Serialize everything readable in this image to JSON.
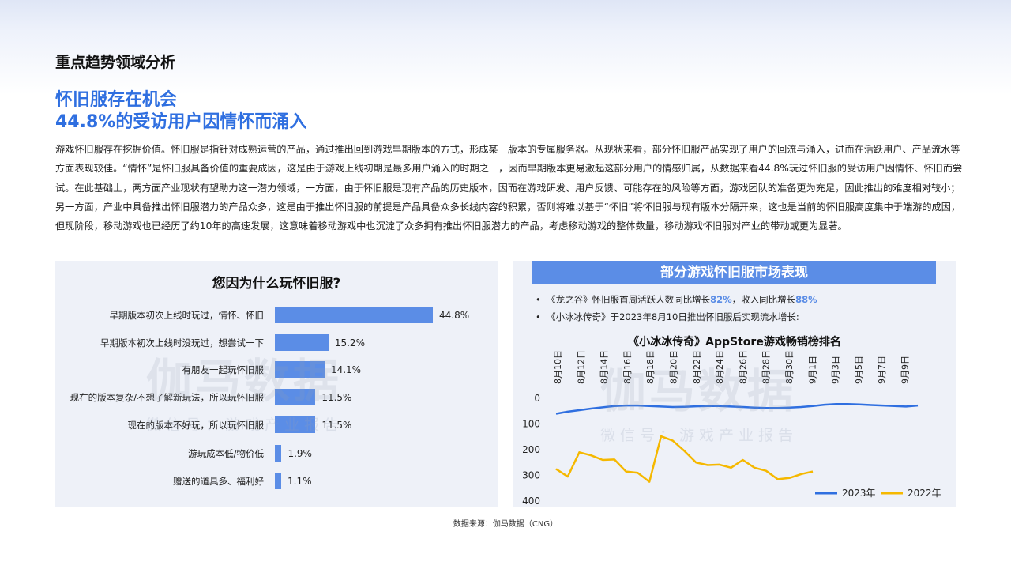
{
  "header": {
    "title": "重点趋势领域分析"
  },
  "headline": {
    "line1": "怀旧服存在机会",
    "line2": "44.8%的受访用户因情怀而涌入"
  },
  "body_text": "游戏怀旧服存在挖掘价值。怀旧服是指针对成熟运营的产品，通过推出回到游戏早期版本的方式，形成某一版本的专属服务器。从现状来看，部分怀旧服产品实现了用户的回流与涌入，进而在活跃用户、产品流水等方面表现较佳。“情怀”是怀旧服具备价值的重要成因，这是由于游戏上线初期是最多用户涌入的时期之一，因而早期版本更易激起这部分用户的情感归属，从数据来看44.8%玩过怀旧服的受访用户因情怀、怀旧而尝试。在此基础上，两方面产业现状有望助力这一潜力领域，一方面，由于怀旧服是现有产品的历史版本，因而在游戏研发、用户反馈、可能存在的风险等方面，游戏团队的准备更为充足，因此推出的难度相对较小；另一方面，产业中具备推出怀旧服潜力的产品众多，这是由于推出怀旧服的前提是产品具备众多长线内容的积累，否则将难以基于“怀旧”将怀旧服与现有版本分隔开来，这也是当前的怀旧服高度集中于端游的成因，但现阶段，移动游戏也已经历了约10年的高速发展，这意味着移动游戏中也沉淀了众多拥有推出怀旧服潜力的产品，考虑移动游戏的整体数量，移动游戏怀旧服对产业的带动或更为显著。",
  "watermark": {
    "main": "伽马数据",
    "sub": "微信号：游戏产业报告"
  },
  "left_panel": {
    "title": "您因为什么玩怀旧服?",
    "chart_data": {
      "type": "bar",
      "orientation": "horizontal",
      "categories": [
        "早期版本初次上线时玩过，情怀、怀旧",
        "早期版本初次上线时没玩过，想尝试一下",
        "有朋友一起玩怀旧服",
        "现在的版本复杂/不想了解新玩法，所以玩怀旧服",
        "现在的版本不好玩，所以玩怀旧服",
        "游玩成本低/物价低",
        "赠送的道具多、福利好"
      ],
      "values": [
        44.8,
        15.2,
        14.1,
        11.5,
        11.5,
        1.9,
        1.1
      ],
      "value_labels": [
        "44.8%",
        "15.2%",
        "14.1%",
        "11.5%",
        "11.5%",
        "1.9%",
        "1.1%"
      ],
      "color": "#5b8de6"
    }
  },
  "right_panel": {
    "banner": "部分游戏怀旧服市场表现",
    "bullet1": {
      "prefix": "《龙之谷》怀旧服首周活跃人数同比增长",
      "v1": "82%",
      "mid": "，收入同比增长",
      "v2": "88%"
    },
    "bullet2": "《小冰冰传奇》于2023年8月10日推出怀旧服后实现流水增长:",
    "chart_title": "《小冰冰传奇》AppStore游戏畅销榜排名",
    "chart_data": {
      "type": "line",
      "y_inverted": true,
      "ylim": [
        0,
        400
      ],
      "yticks": [
        0,
        100,
        200,
        300,
        400
      ],
      "x_labels": [
        "8月10日",
        "8月12日",
        "8月14日",
        "8月16日",
        "8月18日",
        "8月20日",
        "8月22日",
        "8月24日",
        "8月26日",
        "8月28日",
        "8月30日",
        "9月1日",
        "9月3日",
        "9月5日",
        "9月7日",
        "9月9日"
      ],
      "series": [
        {
          "name": "2023年",
          "color": "#2f6fe0",
          "values": [
            60,
            52,
            46,
            40,
            35,
            30,
            28,
            28,
            30,
            32,
            34,
            33,
            31,
            30,
            30,
            32,
            34,
            36,
            38,
            38,
            36,
            34,
            30,
            25,
            22,
            22,
            24,
            26,
            28,
            30,
            32,
            28
          ]
        },
        {
          "name": "2022年",
          "color": "#f5b800",
          "values": [
            275,
            305,
            210,
            222,
            240,
            238,
            285,
            290,
            325,
            148,
            165,
            205,
            250,
            260,
            258,
            270,
            240,
            270,
            282,
            315,
            310,
            295,
            285
          ]
        }
      ]
    }
  },
  "source": "数据来源：伽马数据（CNG）"
}
